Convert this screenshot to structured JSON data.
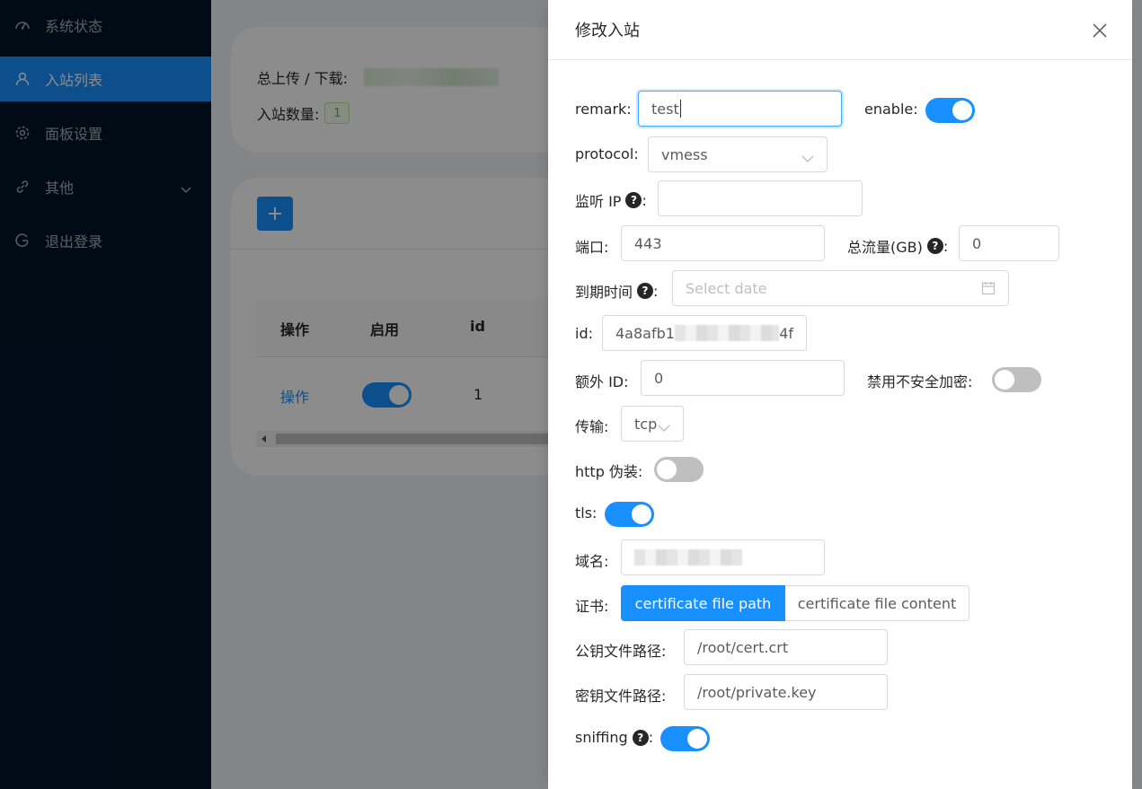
{
  "sidebar": {
    "items": [
      {
        "label": "系统状态",
        "icon": "dashboard-icon",
        "active": false
      },
      {
        "label": "入站列表",
        "icon": "user-icon",
        "active": true
      },
      {
        "label": "面板设置",
        "icon": "gear-icon",
        "active": false
      },
      {
        "label": "其他",
        "icon": "link-icon",
        "active": false
      },
      {
        "label": "退出登录",
        "icon": "logout-icon",
        "active": false
      }
    ]
  },
  "main": {
    "stats": {
      "upload_download_label": "总上传 / 下载:",
      "inbound_count_label": "入站数量:",
      "inbound_count": "1"
    },
    "add_button_icon": "plus-icon",
    "table": {
      "headers": [
        "操作",
        "启用",
        "id"
      ],
      "rows": [
        {
          "action": "操作",
          "enabled": true,
          "id": "1"
        }
      ]
    }
  },
  "drawer": {
    "title": "修改入站",
    "close_icon": "close-icon",
    "fields": {
      "remark": {
        "label": "remark:",
        "value": "test"
      },
      "enable": {
        "label": "enable:",
        "on": true
      },
      "protocol": {
        "label": "protocol:",
        "value": "vmess"
      },
      "listen_ip": {
        "label": "监听 IP",
        "value": ""
      },
      "port": {
        "label": "端口:",
        "value": "443"
      },
      "total_traffic": {
        "label": "总流量(GB)",
        "value": "0"
      },
      "expiry": {
        "label": "到期时间",
        "placeholder": "Select date"
      },
      "id": {
        "label": "id:",
        "value_start": "4a8afb1",
        "value_end": "4f"
      },
      "alter_id": {
        "label": "额外 ID:",
        "value": "0"
      },
      "disable_insecure": {
        "label": "禁用不安全加密:",
        "on": false
      },
      "transport": {
        "label": "传输:",
        "value": "tcp"
      },
      "http_obfs": {
        "label": "http 伪装:",
        "on": false
      },
      "tls": {
        "label": "tls:",
        "on": true
      },
      "domain": {
        "label": "域名:"
      },
      "certificate": {
        "label": "证书:",
        "options": [
          "certificate file path",
          "certificate file content"
        ],
        "selected": 0
      },
      "public_key_path": {
        "label": "公钥文件路径:",
        "value": "/root/cert.crt"
      },
      "private_key_path": {
        "label": "密钥文件路径:",
        "value": "/root/private.key"
      },
      "sniffing": {
        "label": "sniffing",
        "on": true
      }
    },
    "colon": ":"
  },
  "colors": {
    "primary": "#1890ff",
    "sidebar_bg": "#001529",
    "switch_off": "#bfbfbf"
  }
}
